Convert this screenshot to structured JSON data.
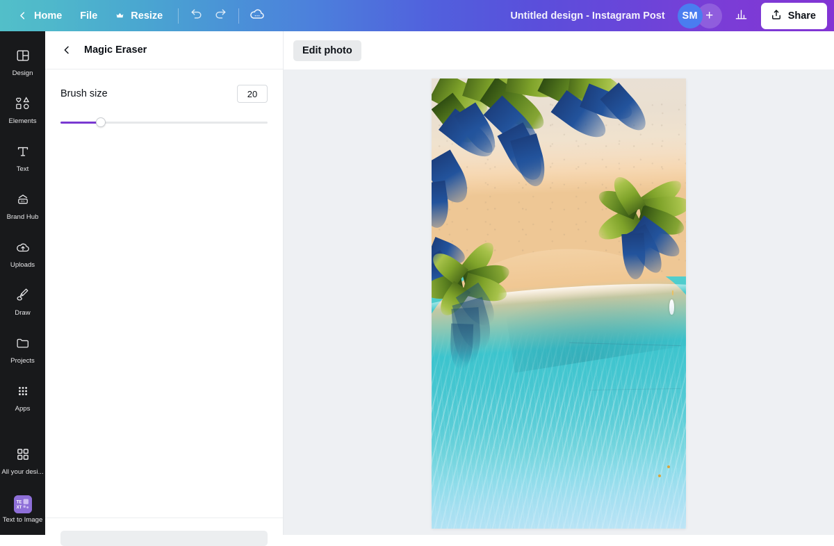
{
  "topbar": {
    "back_icon": "chevron-left-icon",
    "home_label": "Home",
    "file_label": "File",
    "resize_icon": "crown-icon",
    "resize_label": "Resize",
    "undo_icon": "undo-arrow-icon",
    "redo_icon": "redo-arrow-icon",
    "cloud_icon": "cloud-saving-icon",
    "doc_title": "Untitled design - Instagram Post",
    "avatar_initials": "SM",
    "add_collaborator_label": "+",
    "analytics_icon": "bar-chart-icon",
    "share_icon": "share-upload-icon",
    "share_label": "Share",
    "gradient_start": "#52bfc9",
    "gradient_mid": "#5160dd",
    "gradient_end": "#8234d4",
    "avatar_color": "#4a7df0"
  },
  "rail": {
    "items": [
      {
        "icon": "design-layout-icon",
        "label": "Design"
      },
      {
        "icon": "elements-shapes-icon",
        "label": "Elements"
      },
      {
        "icon": "text-t-icon",
        "label": "Text"
      },
      {
        "icon": "brand-hub-icon",
        "label": "Brand Hub"
      },
      {
        "icon": "upload-cloud-icon",
        "label": "Uploads"
      },
      {
        "icon": "draw-pen-icon",
        "label": "Draw"
      },
      {
        "icon": "projects-folder-icon",
        "label": "Projects"
      },
      {
        "icon": "apps-grid-icon",
        "label": "Apps"
      }
    ],
    "bottom_items": [
      {
        "icon": "all-designs-grid-icon",
        "label": "All your desi..."
      },
      {
        "icon": "text-to-image-icon",
        "label": "Text to Image"
      }
    ],
    "background": "#18191b"
  },
  "panel": {
    "back_icon": "chevron-left-icon",
    "title": "Magic Eraser",
    "brush": {
      "label": "Brush size",
      "value": "20",
      "min": 1,
      "max": 100,
      "fill_percent": 19.6,
      "accent_color": "#7a39d1"
    }
  },
  "workspace": {
    "edit_photo_label": "Edit photo",
    "canvas_background": "#eef0f3"
  },
  "artwork": {
    "name": "aerial-tropical-beach-photo",
    "description": "Aerial view of a tropical beach with palm trees, pale sand and turquoise lagoon water with a small white boat",
    "palette": {
      "sand": "#f0e2ce",
      "wet_sand": "#f3cfa2",
      "shallow_water": "#4fcdcd",
      "deep_water": "#3cc4cd",
      "pale_water": "#bfe5f6",
      "palm_green": "#7fa32a",
      "palm_shadow": "#22539c"
    }
  }
}
